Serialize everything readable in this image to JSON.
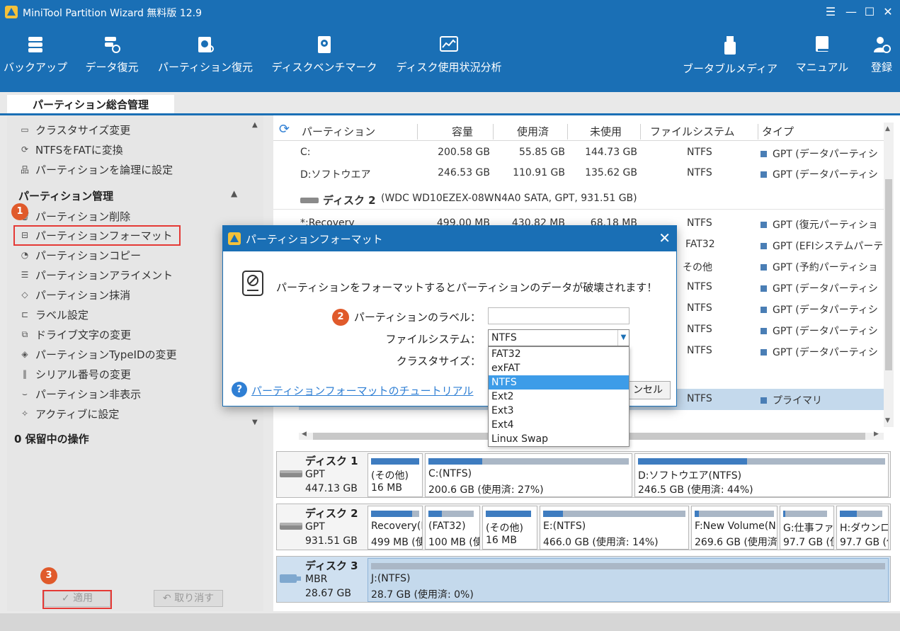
{
  "app": {
    "title": "MiniTool Partition Wizard 無料版 12.9"
  },
  "window_controls": {
    "menu": "☰",
    "minimize": "—",
    "maximize": "☐",
    "close": "✕"
  },
  "toolbar": {
    "backup": "バックアップ",
    "data_recovery": "データ復元",
    "partition_recovery": "パーティション復元",
    "disk_benchmark": "ディスクベンチマーク",
    "space_analyzer": "ディスク使用状況分析",
    "bootable_media": "ブータブルメディア",
    "manual": "マニュアル",
    "register": "登録"
  },
  "tab": {
    "label": "パーティション総合管理"
  },
  "left_panel": {
    "top_items": [
      "クラスタサイズ変更",
      "NTFSをFATに変換",
      "パーティションを論理に設定"
    ],
    "section_title": "パーティション管理",
    "items": [
      "パーティション削除",
      "パーティションフォーマット",
      "パーティションコピー",
      "パーティションアライメント",
      "パーティション抹消",
      "ラベル設定",
      "ドライブ文字の変更",
      "パーティションTypeIDの変更",
      "シリアル番号の変更",
      "パーティション非表示",
      "アクティブに設定"
    ],
    "pending": "0 保留中の操作",
    "apply": "✓ 適用",
    "undo": "↶ 取り消す"
  },
  "badges": {
    "one": "1",
    "two": "2",
    "three": "3"
  },
  "table": {
    "headers": {
      "partition": "パーティション",
      "capacity": "容量",
      "used": "使用済",
      "unused": "未使用",
      "fs": "ファイルシステム",
      "type": "タイプ"
    },
    "rows": [
      {
        "name": "C:",
        "cap": "200.58 GB",
        "used": "55.85 GB",
        "free": "144.73 GB",
        "fs": "NTFS",
        "type": "GPT (データパーティシ"
      },
      {
        "name": "D:ソフトウエア",
        "cap": "246.53 GB",
        "used": "110.91 GB",
        "free": "135.62 GB",
        "fs": "NTFS",
        "type": "GPT (データパーティシ"
      },
      {
        "name": "*:Recovery",
        "cap": "499.00 MB",
        "used": "430.82 MB",
        "free": "68.18 MB",
        "fs": "NTFS",
        "type": "GPT (復元パーティショ"
      },
      {
        "name": "",
        "cap": "",
        "used": "",
        "free": "",
        "fs": "FAT32",
        "type": "GPT (EFIシステムパーテ"
      },
      {
        "name": "",
        "cap": "",
        "used": "",
        "free": "",
        "fs": "その他",
        "type": "GPT (予約パーティショ"
      },
      {
        "name": "",
        "cap": "",
        "used": "",
        "free": "",
        "fs": "NTFS",
        "type": "GPT (データパーティシ"
      },
      {
        "name": "",
        "cap": "",
        "used": "",
        "free": "",
        "fs": "NTFS",
        "type": "GPT (データパーティシ"
      },
      {
        "name": "",
        "cap": "",
        "used": "",
        "free": "",
        "fs": "NTFS",
        "type": "GPT (データパーティシ"
      },
      {
        "name": "",
        "cap": "",
        "used": "",
        "free": "",
        "fs": "NTFS",
        "type": "GPT (データパーティシ"
      },
      {
        "name": "",
        "cap": "",
        "used": "",
        "free": "",
        "fs": "NTFS",
        "type": "プライマリ"
      }
    ],
    "disk2_header": {
      "name": "ディスク 2",
      "detail": "(WDC WD10EZEX-08WN4A0 SATA, GPT, 931.51 GB)"
    }
  },
  "disks": [
    {
      "name": "ディスク 1",
      "type": "GPT",
      "size": "447.13 GB",
      "parts": [
        {
          "l1": "(その他)",
          "l2": "16 MB",
          "fill": 1.0
        },
        {
          "l1": "C:(NTFS)",
          "l2": "200.6 GB (使用済: 27%)",
          "fill": 0.27
        },
        {
          "l1": "D:ソフトウエア(NTFS)",
          "l2": "246.5 GB (使用済: 44%)",
          "fill": 0.44
        }
      ]
    },
    {
      "name": "ディスク 2",
      "type": "GPT",
      "size": "931.51 GB",
      "parts": [
        {
          "l1": "Recovery(N",
          "l2": "499 MB (使",
          "fill": 0.86
        },
        {
          "l1": "(FAT32)",
          "l2": "100 MB (使",
          "fill": 0.3
        },
        {
          "l1": "(その他)",
          "l2": "16 MB",
          "fill": 1.0
        },
        {
          "l1": "E:(NTFS)",
          "l2": "466.0 GB (使用済: 14%)",
          "fill": 0.14
        },
        {
          "l1": "F:New Volume(N",
          "l2": "269.6 GB (使用済",
          "fill": 0.05
        },
        {
          "l1": "G:仕事ファ",
          "l2": "97.7 GB (使",
          "fill": 0.05
        },
        {
          "l1": "H:ダウンロ",
          "l2": "97.7 GB (使",
          "fill": 0.4
        }
      ]
    },
    {
      "name": "ディスク 3",
      "type": "MBR",
      "size": "28.67 GB",
      "parts": [
        {
          "l1": "J:(NTFS)",
          "l2": "28.7 GB (使用済: 0%)",
          "fill": 0.0
        }
      ]
    }
  ],
  "dialog": {
    "title": "パーティションフォーマット",
    "close": "✕",
    "warning": "パーティションをフォーマットするとパーティションのデータが破壊されます！",
    "label_field": "パーティションのラベル：",
    "label_value": "",
    "fs_field": "ファイルシステム：",
    "fs_value": "NTFS",
    "cluster_field": "クラスタサイズ：",
    "help": "?",
    "link": "パーティションフォーマットのチュートリアル",
    "cancel": "ンセル"
  },
  "fs_options": [
    "FAT32",
    "exFAT",
    "NTFS",
    "Ext2",
    "Ext3",
    "Ext4",
    "Linux Swap"
  ],
  "fs_selected_index": 2
}
